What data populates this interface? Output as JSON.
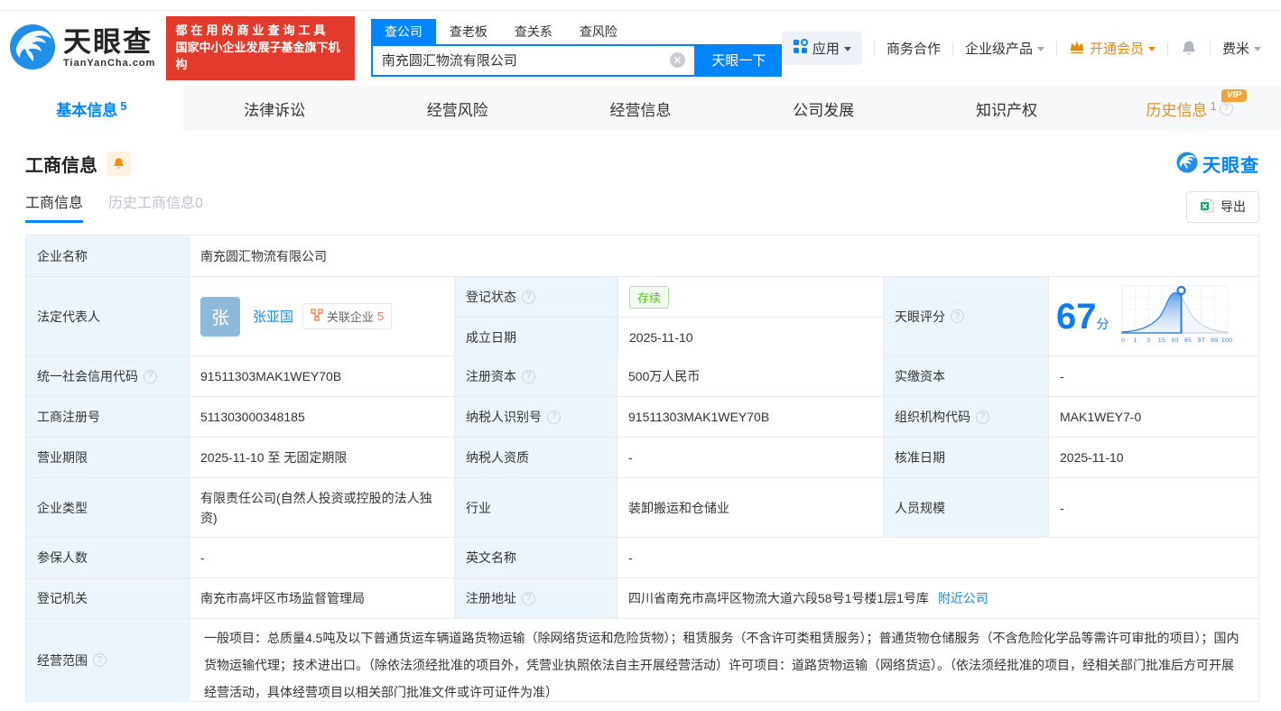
{
  "header": {
    "logo": {
      "title": "天眼查",
      "subtitle": "TianYanCha.com"
    },
    "slogan": {
      "line1": "都在用的商业查询工具",
      "line2": "国家中小企业发展子基金旗下机构"
    },
    "search": {
      "tabs": [
        {
          "label": "查公司"
        },
        {
          "label": "查老板"
        },
        {
          "label": "查关系"
        },
        {
          "label": "查风险"
        }
      ],
      "value": "南充圆汇物流有限公司",
      "button": "天眼一下"
    },
    "nav": {
      "apps": "应用",
      "cooperation": "商务合作",
      "enterprise": "企业级产品",
      "vip": "开通会员",
      "user": "费米"
    }
  },
  "tabs": [
    {
      "label": "基本信息",
      "count": "5"
    },
    {
      "label": "法律诉讼",
      "count": ""
    },
    {
      "label": "经营风险",
      "count": ""
    },
    {
      "label": "经营信息",
      "count": ""
    },
    {
      "label": "公司发展",
      "count": ""
    },
    {
      "label": "知识产权",
      "count": ""
    },
    {
      "label": "历史信息",
      "count": "1",
      "badge": "VIP"
    }
  ],
  "section": {
    "title": "工商信息",
    "watermark": "天眼查",
    "subtab_active": "工商信息",
    "subtab_history": "历史工商信息0",
    "export_label": "导出"
  },
  "company": {
    "name_label": "企业名称",
    "name": "南充圆汇物流有限公司",
    "legal_label": "法定代表人",
    "legal_avatar": "张",
    "legal_name": "张亚国",
    "related_label": "关联企业",
    "related_count": "5",
    "status_label": "登记状态",
    "status": "存续",
    "established_label": "成立日期",
    "established": "2025-11-10",
    "score_label": "天眼评分",
    "score": "67",
    "score_unit": "分",
    "credit_code_label": "统一社会信用代码",
    "credit_code": "91511303MAK1WEY70B",
    "reg_capital_label": "注册资本",
    "reg_capital": "500万人民币",
    "paid_capital_label": "实缴资本",
    "paid_capital": "-",
    "reg_number_label": "工商注册号",
    "reg_number": "511303000348185",
    "taxpayer_id_label": "纳税人识别号",
    "taxpayer_id": "91511303MAK1WEY70B",
    "org_code_label": "组织机构代码",
    "org_code": "MAK1WEY7-0",
    "term_label": "营业期限",
    "term": "2025-11-10 至 无固定期限",
    "taxpayer_quality_label": "纳税人资质",
    "taxpayer_quality": "-",
    "approval_date_label": "核准日期",
    "approval_date": "2025-11-10",
    "type_label": "企业类型",
    "type": "有限责任公司(自然人投资或控股的法人独资)",
    "industry_label": "行业",
    "industry": "装卸搬运和仓储业",
    "staff_label": "人员规模",
    "staff": "-",
    "insured_label": "参保人数",
    "insured": "-",
    "english_label": "英文名称",
    "english": "-",
    "authority_label": "登记机关",
    "authority": "南充市高坪区市场监督管理局",
    "address_label": "注册地址",
    "address": "四川省南充市高坪区物流大道六段58号1号楼1层1号库",
    "address_link": "附近公司",
    "scope_label": "经营范围",
    "scope": "一般项目：总质量4.5吨及以下普通货运车辆道路货物运输（除网络货运和危险货物）；租赁服务（不含许可类租赁服务）；普通货物仓储服务（不含危险化学品等需许可审批的项目）；国内货物运输代理；技术进出口。（除依法须经批准的项目外，凭营业执照依法自主开展经营活动）许可项目：道路货物运输（网络货运）。（依法须经批准的项目，经相关部门批准后方可开展经营活动，具体经营项目以相关部门批准文件或许可证件为准）"
  },
  "score_chart": {
    "type": "area",
    "score": 67,
    "range": [
      0,
      100
    ],
    "ticks": [
      "0",
      "1",
      "3",
      "15",
      "50",
      "85",
      "97",
      "99",
      "100"
    ]
  },
  "colors": {
    "accent_blue": "#0084ff",
    "link_blue": "#1e88e5",
    "member_orange": "#e8890c",
    "status_green": "#52c41a",
    "slogan_red": "#e23b2e",
    "label_cell_bg": "#edf5fc",
    "history_tab_orange": "#d6912f"
  }
}
